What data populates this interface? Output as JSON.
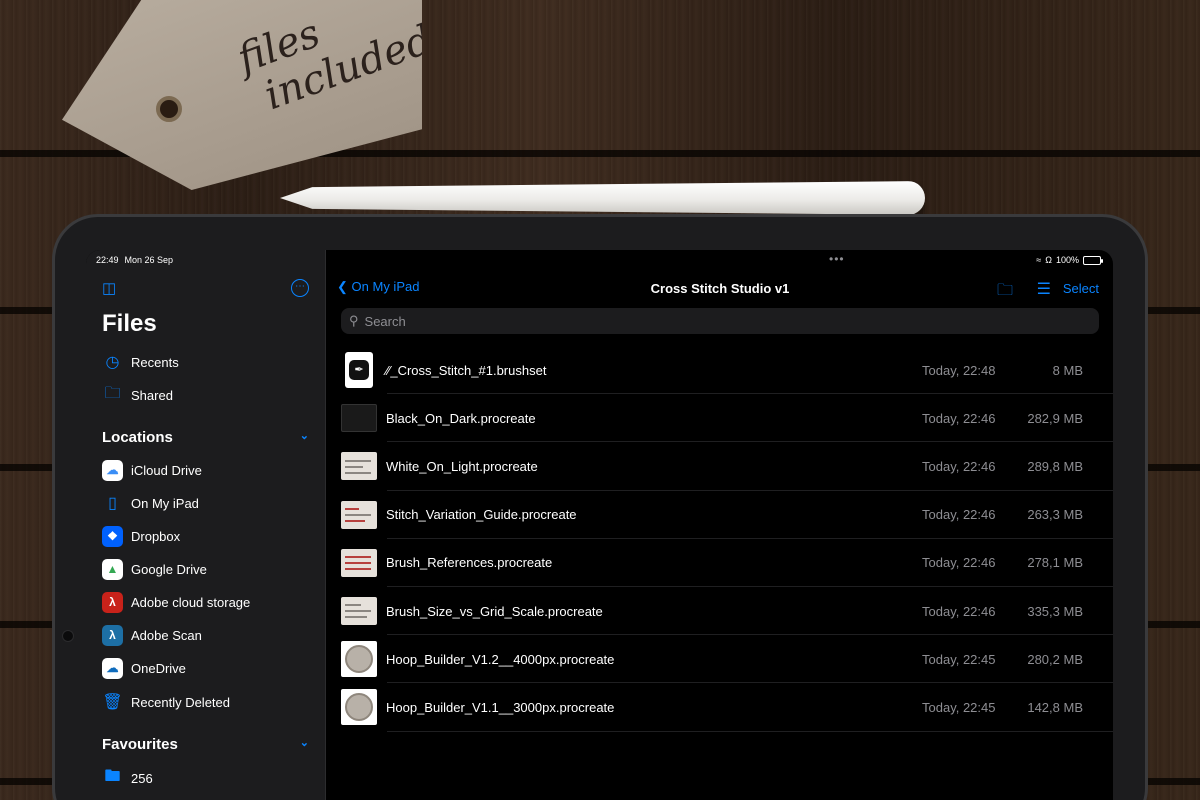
{
  "tag": {
    "text": "files included"
  },
  "status_bar": {
    "time": "22:49",
    "date": "Mon 26 Sep",
    "battery": "100%",
    "battery_level": 1.0
  },
  "sidebar": {
    "title": "Files",
    "top_items": [
      {
        "label": "Recents",
        "icon": "clock-icon"
      },
      {
        "label": "Shared",
        "icon": "shared-folder-icon"
      }
    ],
    "locations_header": "Locations",
    "locations": [
      {
        "label": "iCloud Drive",
        "icon": "icloud-icon",
        "color": "#3a8ef6"
      },
      {
        "label": "On My iPad",
        "icon": "ipad-icon",
        "color": "#0a84ff"
      },
      {
        "label": "Dropbox",
        "icon": "dropbox-icon",
        "color": "#0061fe"
      },
      {
        "label": "Google Drive",
        "icon": "google-drive-icon",
        "color": "#34a853"
      },
      {
        "label": "Adobe cloud storage",
        "icon": "adobe-cloud-icon",
        "color": "#c8221a"
      },
      {
        "label": "Adobe Scan",
        "icon": "adobe-scan-icon",
        "color": "#1d6fa5"
      },
      {
        "label": "OneDrive",
        "icon": "onedrive-icon",
        "color": "#0f6cbd"
      },
      {
        "label": "Recently Deleted",
        "icon": "trash-icon",
        "color": "#0a84ff"
      }
    ],
    "favourites_header": "Favourites",
    "favourites": [
      {
        "label": "256",
        "icon": "folder-icon"
      }
    ]
  },
  "nav": {
    "back_label": "On My iPad",
    "title": "Cross Stitch Studio v1",
    "select_label": "Select"
  },
  "search": {
    "placeholder": "Search"
  },
  "files": [
    {
      "name": "∕∕_Cross_Stitch_#1.brushset",
      "date": "Today, 22:48",
      "size": "8 MB"
    },
    {
      "name": "Black_On_Dark.procreate",
      "date": "Today, 22:46",
      "size": "282,9 MB"
    },
    {
      "name": "White_On_Light.procreate",
      "date": "Today, 22:46",
      "size": "289,8 MB"
    },
    {
      "name": "Stitch_Variation_Guide.procreate",
      "date": "Today, 22:46",
      "size": "263,3 MB"
    },
    {
      "name": "Brush_References.procreate",
      "date": "Today, 22:46",
      "size": "278,1 MB"
    },
    {
      "name": "Brush_Size_vs_Grid_Scale.procreate",
      "date": "Today, 22:46",
      "size": "335,3 MB"
    },
    {
      "name": "Hoop_Builder_V1.2__4000px.procreate",
      "date": "Today, 22:45",
      "size": "280,2 MB"
    },
    {
      "name": "Hoop_Builder_V1.1__3000px.procreate",
      "date": "Today, 22:45",
      "size": "142,8 MB"
    }
  ],
  "colors": {
    "accent": "#0a84ff",
    "background": "#000000",
    "sidebar": "#1c1c1e"
  }
}
